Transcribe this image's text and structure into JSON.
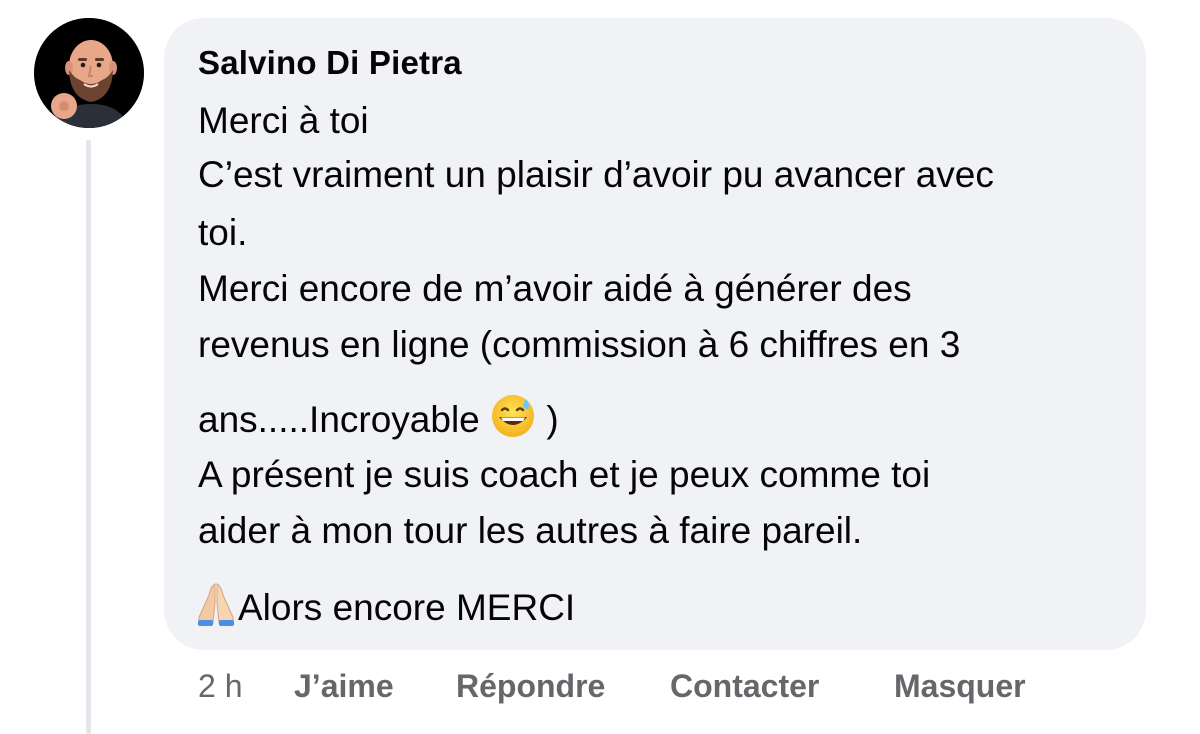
{
  "comment": {
    "author": "Salvino Di Pietra",
    "lines": [
      "Merci à toi",
      "C’est vraiment un plaisir d’avoir pu avancer avec",
      "toi.",
      "Merci encore de m’avoir aidé à générer des",
      "revenus en ligne (commission à 6 chiffres en 3",
      "ans.....Incroyable",
      ")",
      "A présent je suis coach et je peux comme toi",
      "aider à mon tour les autres à faire pareil.",
      "Alors encore MERCI"
    ],
    "emojis": {
      "sweat_smile": "grinning-face-with-sweat-icon",
      "pray": "folded-hands-icon"
    }
  },
  "actions": {
    "time": "2 h",
    "like": "J’aime",
    "reply": "Répondre",
    "contact": "Contacter",
    "hide": "Masquer"
  },
  "colors": {
    "bubble": "#f0f2f5",
    "text": "#050505",
    "secondary": "#65676b",
    "thread_line": "#e4e6eb"
  }
}
